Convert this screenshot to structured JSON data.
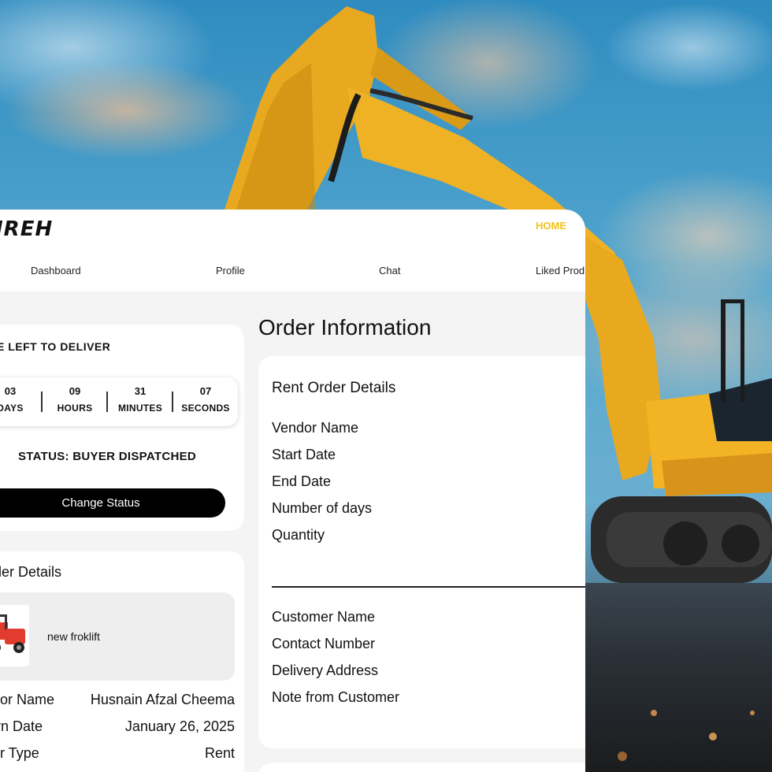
{
  "brand": {
    "logo_text": "IREH"
  },
  "header": {
    "home_label": "HOME"
  },
  "nav": {
    "items": [
      {
        "label": "Dashboard"
      },
      {
        "label": "Profile"
      },
      {
        "label": "Chat"
      },
      {
        "label": "Liked Prod"
      }
    ]
  },
  "delivery": {
    "title": "E LEFT TO DELIVER",
    "countdown": [
      {
        "value": "03",
        "label": "DAYS"
      },
      {
        "value": "09",
        "label": "HOURS"
      },
      {
        "value": "31",
        "label": "MINUTES"
      },
      {
        "value": "07",
        "label": "SECONDS"
      }
    ],
    "status_text": "STATUS: BUYER DISPATCHED",
    "change_status_label": "Change Status"
  },
  "order_details": {
    "title": "der Details",
    "product": {
      "name": "new froklift",
      "icon": "forklift-icon"
    },
    "rows": [
      {
        "label": "ndor Name",
        "value": "Husnain Afzal Cheema"
      },
      {
        "label": "turn Date",
        "value": "January 26, 2025"
      },
      {
        "label": "der Type",
        "value": "Rent"
      }
    ]
  },
  "order_information": {
    "title": "Order Information",
    "rent_card_title": "Rent Order Details",
    "rent_fields": [
      "Vendor Name",
      "Start Date",
      "End Date",
      "Number of days",
      "Quantity"
    ],
    "customer_fields": [
      "Customer Name",
      "Contact Number",
      "Delivery Address",
      "Note from Customer"
    ]
  },
  "colors": {
    "accent": "#f2c21a",
    "button_bg": "#000000",
    "panel_bg": "#f4f4f4",
    "card_bg": "#ffffff"
  }
}
